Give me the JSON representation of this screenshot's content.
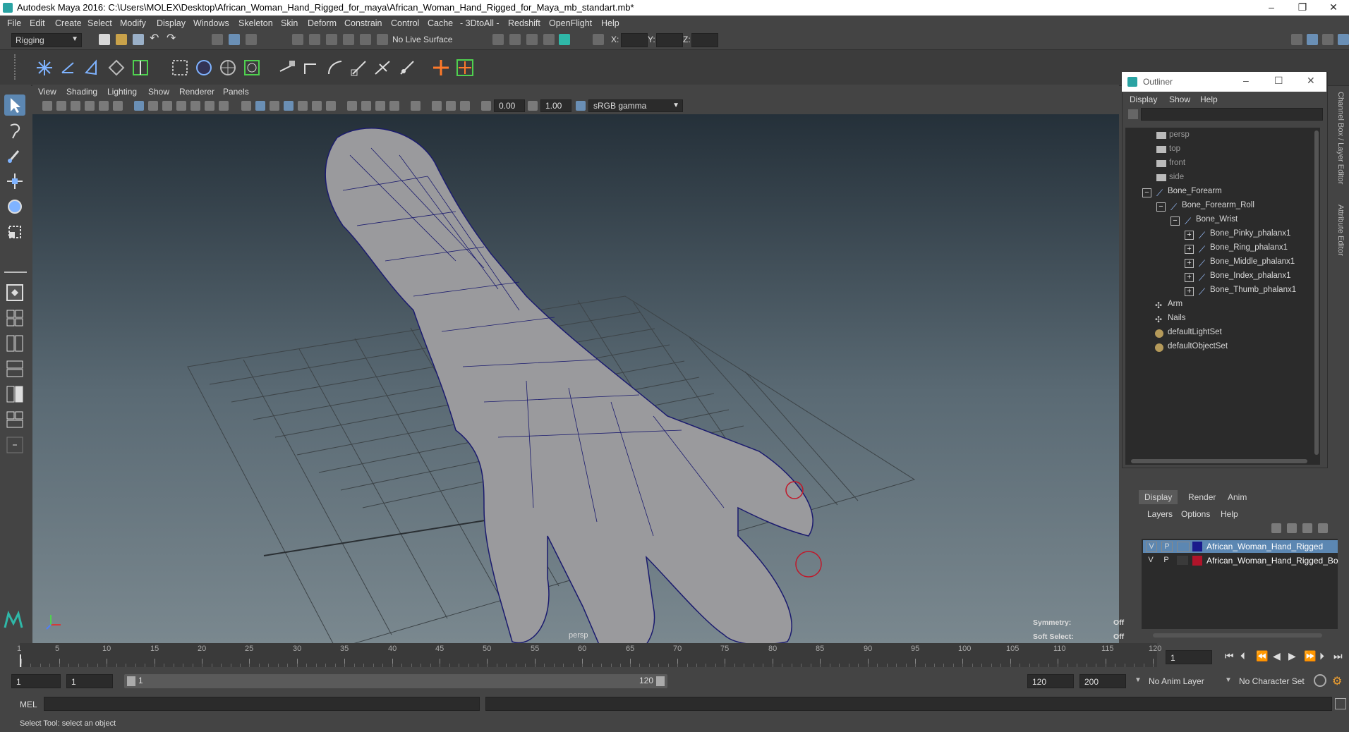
{
  "window": {
    "title": "Autodesk Maya 2016: C:\\Users\\MOLEX\\Desktop\\African_Woman_Hand_Rigged_for_maya\\African_Woman_Hand_Rigged_for_Maya_mb_standart.mb*",
    "minimize": "–",
    "restore": "❐",
    "close": "✕"
  },
  "menubar": [
    "File",
    "Edit",
    "Create",
    "Select",
    "Modify",
    "Display",
    "Windows",
    "Skeleton",
    "Skin",
    "Deform",
    "Constrain",
    "Control",
    "Cache",
    "- 3DtoAll -",
    "Redshift",
    "OpenFlight",
    "Help"
  ],
  "statusline": {
    "menuset": "Rigging",
    "live_surface": "No Live Surface",
    "x_label": "X:",
    "y_label": "Y:",
    "z_label": "Z:"
  },
  "viewport": {
    "menu": [
      "View",
      "Shading",
      "Lighting",
      "Show",
      "Renderer",
      "Panels"
    ],
    "near_value": "0.00",
    "far_value": "1.00",
    "color_space": "sRGB gamma",
    "camera_label": "persp",
    "symmetry_label": "Symmetry:",
    "symmetry_value": "Off",
    "soft_select_label": "Soft Select:",
    "soft_select_value": "Off"
  },
  "outliner": {
    "title": "Outliner",
    "menu": [
      "Display",
      "Show",
      "Help"
    ],
    "items": [
      {
        "label": "persp",
        "dim": true
      },
      {
        "label": "top",
        "dim": true
      },
      {
        "label": "front",
        "dim": true
      },
      {
        "label": "side",
        "dim": true
      },
      {
        "label": "Bone_Forearm",
        "dim": false
      },
      {
        "label": "Bone_Forearm_Roll",
        "dim": false
      },
      {
        "label": "Bone_Wrist",
        "dim": false
      },
      {
        "label": "Bone_Pinky_phalanx1",
        "dim": false
      },
      {
        "label": "Bone_Ring_phalanx1",
        "dim": false
      },
      {
        "label": "Bone_Middle_phalanx1",
        "dim": false
      },
      {
        "label": "Bone_Index_phalanx1",
        "dim": false
      },
      {
        "label": "Bone_Thumb_phalanx1",
        "dim": false
      },
      {
        "label": "Arm",
        "dim": false
      },
      {
        "label": "Nails",
        "dim": false
      },
      {
        "label": "defaultLightSet",
        "dim": false
      },
      {
        "label": "defaultObjectSet",
        "dim": false
      }
    ]
  },
  "layers": {
    "tabs": [
      "Display",
      "Render",
      "Anim"
    ],
    "menu": [
      "Layers",
      "Options",
      "Help"
    ],
    "rows": [
      {
        "v": "V",
        "p": "P",
        "color": "#1a1a8c",
        "name": "African_Woman_Hand_Rigged",
        "selected": true
      },
      {
        "v": "V",
        "p": "P",
        "color": "#b0142a",
        "name": "African_Woman_Hand_Rigged_Bones",
        "selected": false
      }
    ]
  },
  "side_tabs": {
    "channel_box": "Channel Box / Layer Editor",
    "attribute_editor": "Attribute Editor"
  },
  "timeslider": {
    "ticks": [
      1,
      5,
      10,
      15,
      20,
      25,
      30,
      35,
      40,
      45,
      50,
      55,
      60,
      65,
      70,
      75,
      80,
      85,
      90,
      95,
      100,
      105,
      110,
      115,
      120
    ],
    "current_frame": "1"
  },
  "range": {
    "start": "1",
    "playback_start": "1",
    "slider_start": "1",
    "slider_end": "120",
    "playback_end": "120",
    "end": "200",
    "anim_layer": "No Anim Layer",
    "character_set": "No Character Set"
  },
  "commandline": {
    "label": "MEL"
  },
  "helpline": {
    "text": "Select Tool: select an object"
  }
}
